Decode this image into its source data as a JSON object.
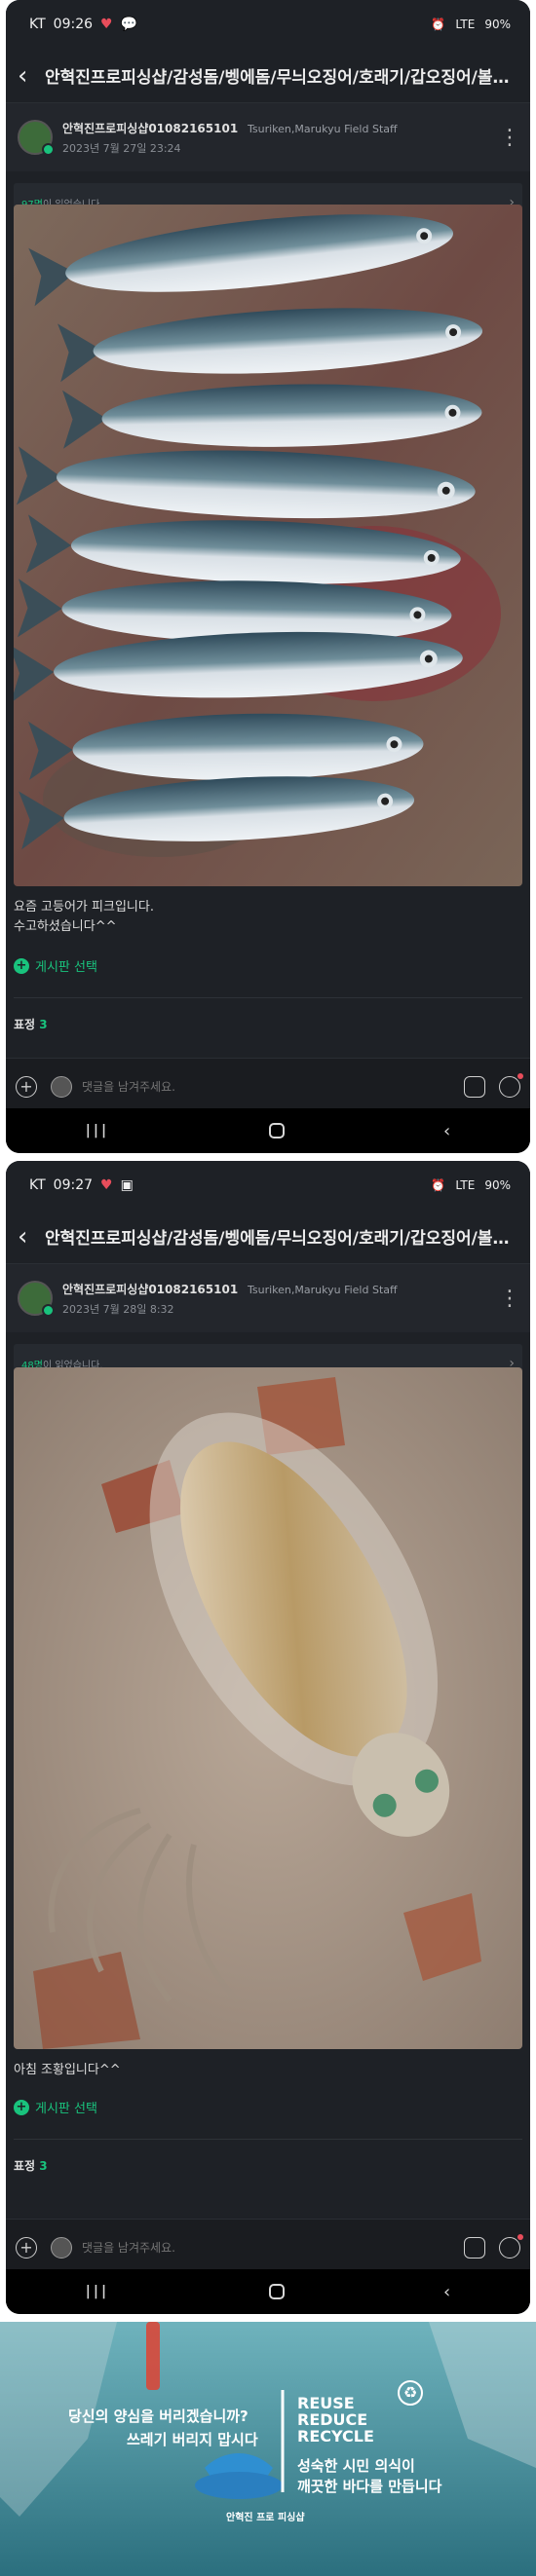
{
  "screens": [
    {
      "status": {
        "carrier": "KT",
        "time": "09:26",
        "battery": "90%",
        "signal": "LTE"
      },
      "title": "안혁진프로피싱샵/감성돔/벵에돔/무늬오징어/호래기/갑오징어/볼락/출조...",
      "author": {
        "name": "안혁진프로피싱샵01082165101",
        "team": "Tsuriken,Marukyu Field Staff",
        "date": "2023년 7월 27일 23:24"
      },
      "reads": {
        "count": "97명",
        "suffix": "이 읽었습니다."
      },
      "post_lines": [
        "요즘 고등어가 피크입니다.",
        "수고하셨습니다^^"
      ],
      "add_selection": "게시판 선택",
      "reactions": {
        "label": "표정",
        "count": "3"
      },
      "comment_placeholder": "댓글을 남겨주세요."
    },
    {
      "status": {
        "carrier": "KT",
        "time": "09:27",
        "battery": "90%",
        "signal": "LTE"
      },
      "title": "안혁진프로피싱샵/감성돔/벵에돔/무늬오징어/호래기/갑오징어/볼락/출조...",
      "author": {
        "name": "안혁진프로피싱샵01082165101",
        "team": "Tsuriken,Marukyu Field Staff",
        "date": "2023년 7월 28일 8:32"
      },
      "reads": {
        "count": "48명",
        "suffix": "이 읽었습니다."
      },
      "post_lines": [
        "아침 조황입니다^^"
      ],
      "add_selection": "게시판 선택",
      "reactions": {
        "label": "표정",
        "count": "3"
      },
      "comment_placeholder": "댓글을 남겨주세요."
    }
  ],
  "banner": {
    "line1": "당신의 양심을 버리겠습니까?",
    "line2": "쓰레기 버리지 맙시다",
    "reuse": "REUSE",
    "reduce": "REDUCE",
    "recycle": "RECYCLE",
    "slogan1": "성숙한 시민 의식이",
    "slogan2": "깨끗한 바다를 만듭니다",
    "shop": "안혁진 프로 피싱샵"
  },
  "colors": {
    "bg": "#1e2126",
    "accent": "#19c37d",
    "banner": "#3e8d9a"
  },
  "icons": [
    "back-icon",
    "more-icon",
    "plus-icon",
    "lock-icon",
    "emoji-icon",
    "chevron-right-icon"
  ]
}
